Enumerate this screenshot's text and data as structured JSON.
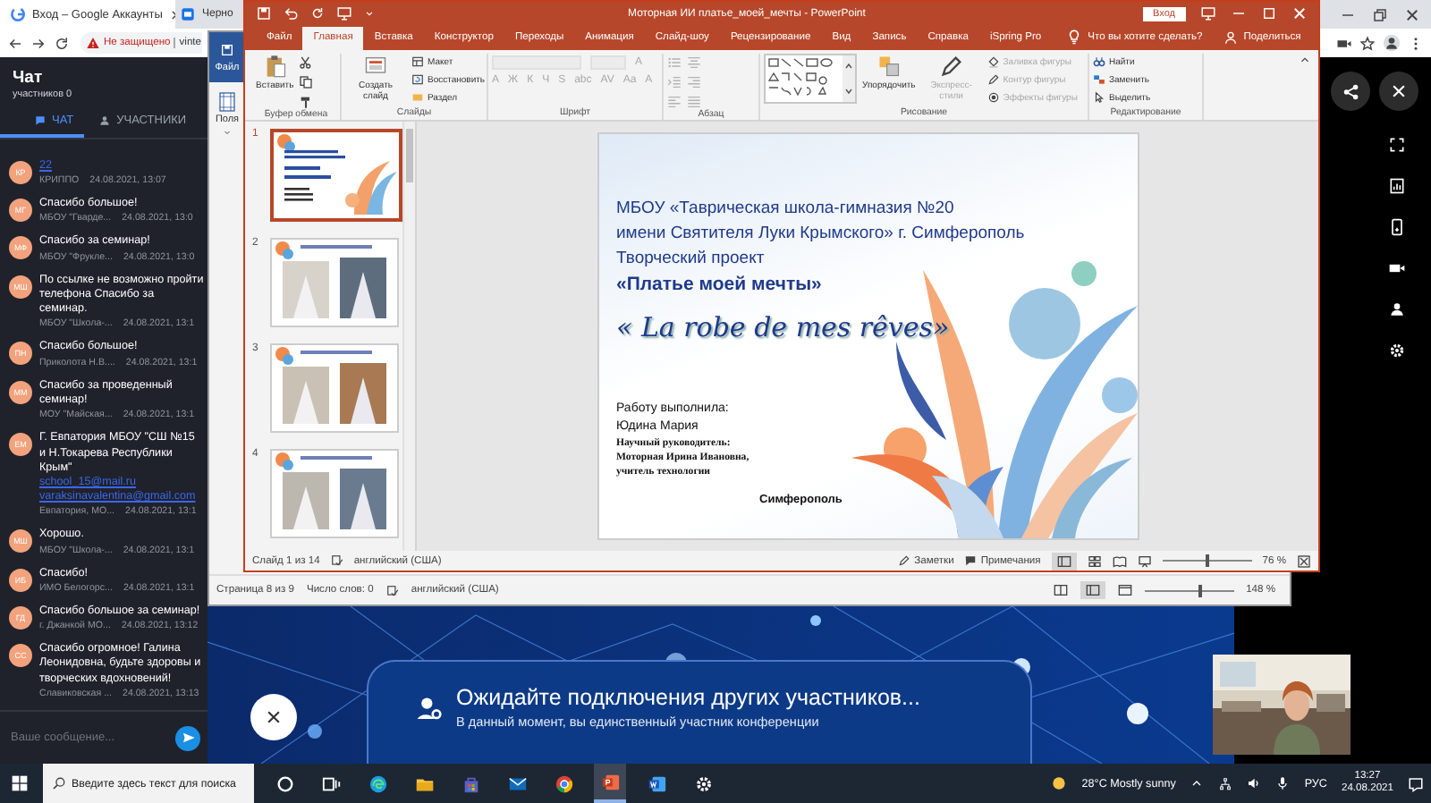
{
  "browser": {
    "tabs": [
      {
        "title": "Вход – Google Аккаунты"
      },
      {
        "title": "Черно"
      }
    ],
    "security_warning": "Не защищено",
    "address": "vinte"
  },
  "chat": {
    "title": "Чат",
    "subtitle": "участников 0",
    "tabs": [
      {
        "label": "ЧАТ",
        "selected": true
      },
      {
        "label": "УЧАСТНИКИ",
        "selected": false
      }
    ],
    "messages": [
      {
        "initials": "КР",
        "links": [
          "22"
        ],
        "sender": "КРИППО",
        "time": "24.08.2021, 13:07"
      },
      {
        "initials": "МГ",
        "text": "Спасибо большое!",
        "sender": "МБОУ \"Гварде...",
        "time": "24.08.2021, 13:0"
      },
      {
        "initials": "МФ",
        "text": "Спасибо за семинар!",
        "sender": "МБОУ \"Фрукле...",
        "time": "24.08.2021, 13:0"
      },
      {
        "initials": "МШ",
        "text": "По ссылке не возможно пройти телефона Спасибо за семинар.",
        "sender": "МБОУ \"Школа-...",
        "time": "24.08.2021, 13:1"
      },
      {
        "initials": "ПН",
        "text": "Спасибо большое!",
        "sender": "Приколота Н.В....",
        "time": "24.08.2021, 13:1"
      },
      {
        "initials": "ММ",
        "text": "Спасибо за проведенный семинар!",
        "sender": "МОУ \"Майская...",
        "time": "24.08.2021, 13:1"
      },
      {
        "initials": "ЕМ",
        "text": "Г. Евпатория МБОУ \"СШ №15 и Н.Токарева Республики Крым\"",
        "links": [
          "school_15@mail.ru",
          "varaksinavalentina@gmail.com"
        ],
        "sender": "Евпатория, МО...",
        "time": "24.08.2021, 13:1"
      },
      {
        "initials": "МШ",
        "text": "Хорошо.",
        "sender": "МБОУ \"Школа-...",
        "time": "24.08.2021, 13:1"
      },
      {
        "initials": "ИБ",
        "text": "Спасибо!",
        "sender": "ИМО Белогорс...",
        "time": "24.08.2021, 13:1"
      },
      {
        "initials": "ГД",
        "text": "Спасибо большое за семинар!",
        "sender": "г. Джанкой МО...",
        "time": "24.08.2021, 13:12"
      },
      {
        "initials": "СС",
        "text": "Спасибо огромное! Галина Леонидовна, будьте здоровы и творческих вдохновений!",
        "sender": "Славиковская ...",
        "time": "24.08.2021, 13:13"
      }
    ],
    "input": {
      "placeholder": "Ваше сообщение..."
    }
  },
  "word": {
    "file_tab": "Файл",
    "margins": "Поля",
    "status": [
      "Страница 8 из 9",
      "Число слов: 0",
      "английский (США)"
    ],
    "zoom": "148 %",
    "zoom_slider": {
      "level": 0.62
    }
  },
  "powerpoint": {
    "title": "Моторная ИИ платье_моей_мечты - PowerPoint",
    "sign_in": "Вход",
    "tabs": [
      {
        "label": "Файл",
        "selected": false
      },
      {
        "label": "Главная",
        "selected": true
      },
      {
        "label": "Вставка",
        "selected": false
      },
      {
        "label": "Конструктор",
        "selected": false
      },
      {
        "label": "Переходы",
        "selected": false
      },
      {
        "label": "Анимация",
        "selected": false
      },
      {
        "label": "Слайд-шоу",
        "selected": false
      },
      {
        "label": "Рецензирование",
        "selected": false
      },
      {
        "label": "Вид",
        "selected": false
      },
      {
        "label": "Запись",
        "selected": false
      },
      {
        "label": "Справка",
        "selected": false
      },
      {
        "label": "iSpring Pro",
        "selected": false
      }
    ],
    "tell_me": "Что вы хотите сделать?",
    "share": "Поделиться",
    "ribbon": [
      {
        "label": "Буфер обмена",
        "items": [
          {
            "kind": "big",
            "text": "Вставить",
            "disabled": false
          },
          {
            "kind": "icon",
            "disabled": false
          },
          {
            "kind": "icon",
            "disabled": false
          },
          {
            "kind": "icon",
            "disabled": false
          }
        ]
      },
      {
        "label": "Слайды",
        "items": [
          {
            "kind": "big",
            "text": "Создать слайд",
            "disabled": false
          },
          {
            "kind": "small",
            "text": "Макет",
            "disabled": false
          },
          {
            "kind": "small",
            "text": "Восстановить",
            "disabled": false
          },
          {
            "kind": "small",
            "text": "Раздел",
            "disabled": false
          }
        ]
      },
      {
        "label": "Шрифт",
        "items": [
          {
            "kind": "combo",
            "disabled": true
          },
          {
            "kind": "combo",
            "disabled": true
          },
          {
            "kind": "glyph",
            "text": "A",
            "disabled": true
          },
          {
            "kind": "glyph",
            "text": "A",
            "disabled": true
          },
          {
            "kind": "glyph",
            "text": "Ж",
            "disabled": true
          },
          {
            "kind": "glyph",
            "text": "К",
            "disabled": true
          },
          {
            "kind": "glyph",
            "text": "Ч",
            "disabled": true
          },
          {
            "kind": "glyph",
            "text": "S",
            "disabled": true
          },
          {
            "kind": "glyph",
            "text": "abc",
            "disabled": true
          },
          {
            "kind": "glyph",
            "text": "AV",
            "disabled": true
          },
          {
            "kind": "glyph",
            "text": "Aa",
            "disabled": true
          },
          {
            "kind": "glyph",
            "text": "A",
            "disabled": true
          }
        ]
      },
      {
        "label": "Абзац",
        "items": [
          {
            "kind": "icon",
            "disabled": true
          },
          {
            "kind": "icon",
            "disabled": true
          },
          {
            "kind": "icon",
            "disabled": true
          },
          {
            "kind": "icon",
            "disabled": true
          },
          {
            "kind": "icon",
            "disabled": true
          },
          {
            "kind": "icon",
            "disabled": true
          }
        ]
      },
      {
        "label": "Рисование",
        "items": [
          {
            "kind": "gallery",
            "disabled": false
          },
          {
            "kind": "big",
            "text": "Упорядочить",
            "disabled": false
          },
          {
            "kind": "big",
            "text": "Экспресс-стили",
            "disabled": true
          },
          {
            "kind": "small",
            "text": "Заливка фигуры",
            "disabled": true
          },
          {
            "kind": "small",
            "text": "Контур фигуры",
            "disabled": true
          },
          {
            "kind": "small",
            "text": "Эффекты фигуры",
            "disabled": true
          }
        ]
      },
      {
        "label": "Редактирование",
        "items": [
          {
            "kind": "small",
            "text": "Найти",
            "disabled": false
          },
          {
            "kind": "small",
            "text": "Заменить",
            "disabled": false
          },
          {
            "kind": "small",
            "text": "Выделить",
            "disabled": false
          }
        ]
      }
    ],
    "slides": [
      {
        "number": "1",
        "selected": true
      },
      {
        "number": "2",
        "selected": false
      },
      {
        "number": "3",
        "selected": false
      },
      {
        "number": "4",
        "selected": false
      }
    ],
    "slide": [
      {
        "kind": "heading",
        "text": "МБОУ «Таврическая школа-гимназия №20"
      },
      {
        "kind": "heading",
        "text": "имени Святителя Луки Крымского»  г. Симферополь"
      },
      {
        "kind": "heading",
        "text": "Творческий проект"
      },
      {
        "kind": "title",
        "text": "«Платье моей мечты»"
      },
      {
        "kind": "script",
        "text": "« La robe de mes rêves»"
      },
      {
        "kind": "body",
        "text": "Работу выполнила:"
      },
      {
        "kind": "body",
        "text": "Юдина Мария"
      },
      {
        "kind": "serif",
        "text": "Научный руководитель:"
      },
      {
        "kind": "serif",
        "text": "Моторная Ирина Ивановна,"
      },
      {
        "kind": "serif",
        "text": "учитель технологии"
      },
      {
        "kind": "footer",
        "text": "Симферополь"
      }
    ],
    "status": {
      "slide": "Слайд 1 из 14",
      "language": "английский (США)",
      "notes": "Заметки",
      "comments": "Примечания",
      "zoom": "76 %",
      "zoom_slider": {
        "level": 0.5
      }
    }
  },
  "waiting": {
    "title": "Ожидайте подключения других участников...",
    "subtitle": "В данный момент, вы единственный участник конференции"
  },
  "taskbar": {
    "search_placeholder": "Введите здесь текст для поиска",
    "apps": [
      {
        "selected": false
      },
      {
        "selected": false
      },
      {
        "selected": false
      },
      {
        "selected": false
      },
      {
        "selected": false
      },
      {
        "selected": false
      },
      {
        "selected": false
      },
      {
        "selected": true
      },
      {
        "selected": false
      },
      {
        "selected": false
      }
    ],
    "weather": "28°C  Mostly sunny",
    "language": "РУС",
    "time": "13:27",
    "date": "24.08.2021"
  }
}
